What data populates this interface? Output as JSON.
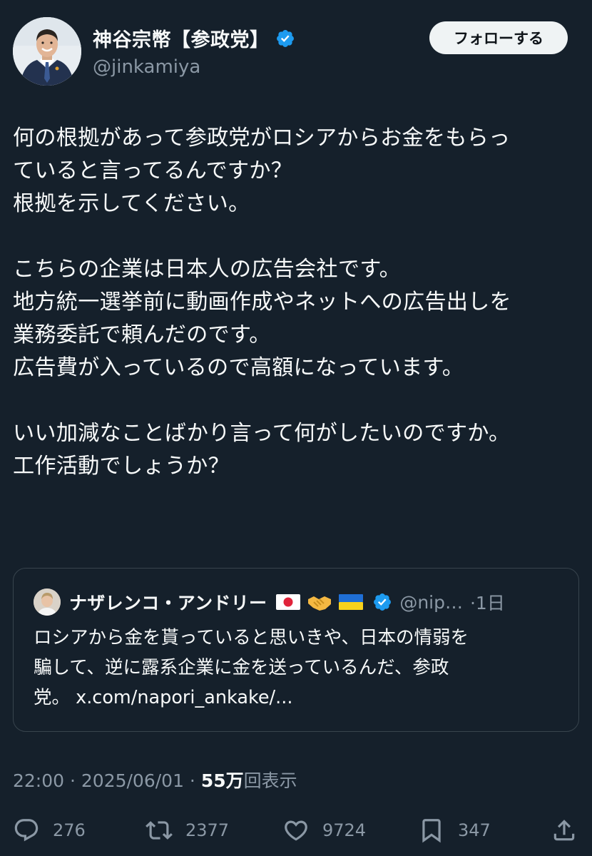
{
  "author": {
    "display_name": "神谷宗幣【参政党】",
    "handle": "@jinkamiya",
    "follow_label": "フォローする",
    "verified": true
  },
  "tweet": {
    "paragraphs": [
      [
        "何の根拠があって参政党がロシアからお金をもらっ",
        "ていると言ってるんですか？",
        "根拠を示してください。"
      ],
      [
        "こちらの企業は日本人の広告会社です。",
        "地方統一選挙前に動画作成やネットへの広告出しを",
        "業務委託で頼んだのです。",
        "広告費が入っているので高額になっています。"
      ],
      [
        "いい加減なことばかり言って何がしたいのですか。",
        "工作活動でしょうか？"
      ]
    ]
  },
  "quote": {
    "name": "ナザレンコ・アンドリー",
    "emojis": [
      "flag-japan",
      "handshake",
      "flag-ukraine"
    ],
    "handle": "@nip…",
    "time": "·1日",
    "lines": [
      "ロシアから金を貰っていると思いきや、日本の情弱を",
      "騙して、逆に露系企業に金を送っているんだ、参政",
      "党。 x.com/napori_ankake/..."
    ]
  },
  "meta": {
    "time": "22:00",
    "sep1": " · ",
    "date": "2025/06/01",
    "sep2": " · ",
    "views_count": "55万",
    "views_label": "回表示"
  },
  "actions": {
    "replies": "276",
    "retweets": "2377",
    "likes": "9724",
    "bookmarks": "347"
  },
  "colors": {
    "background": "#15202b",
    "text": "#f7f9f9",
    "secondary": "#8b98a5",
    "verified": "#1d9bf0",
    "border": "#38444d"
  }
}
